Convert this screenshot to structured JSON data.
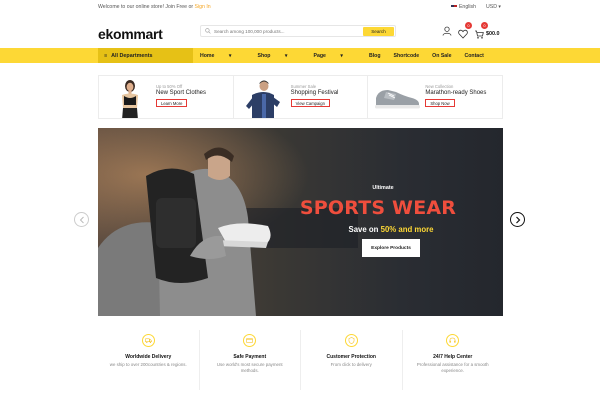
{
  "topbar": {
    "welcome": "Welcome to our online store! Join Free or",
    "signin": "Sign In",
    "language": "English",
    "currency": "USD"
  },
  "header": {
    "logo": "ekommart",
    "search_placeholder": "Search among 100,000 products...",
    "search_button": "Search",
    "wishlist_count": "0",
    "cart_count": "0",
    "cart_price": "$00.0"
  },
  "nav": {
    "departments": "All Departments",
    "items": [
      "Home",
      "Shop",
      "Page",
      "Blog",
      "Shortcode",
      "On Sale",
      "Contact"
    ]
  },
  "promos": [
    {
      "small": "Up to 50% Off",
      "title": "New Sport Clothes",
      "button": "Learn More"
    },
    {
      "small": "Summer Sale",
      "title": "Shopping Festival",
      "button": "View Campaign"
    },
    {
      "small": "New Collection",
      "title": "Marathon-ready Shoes",
      "button": "Shop Now"
    }
  ],
  "hero": {
    "kicker": "Ultimate",
    "headline": "SPORTS WEAR",
    "subline_prefix": "Save on",
    "subline_highlight": "50% and more",
    "cta": "Explore Products"
  },
  "features": [
    {
      "title": "Worldwide Delivery",
      "desc": "we ship to over 200countries & regions.",
      "icon": "truck-icon"
    },
    {
      "title": "Safe Payment",
      "desc": "Use world's most secure payment methods.",
      "icon": "payment-icon"
    },
    {
      "title": "Customer Protection",
      "desc": "From click to delivery",
      "icon": "shield-icon"
    },
    {
      "title": "24/7 Help Center",
      "desc": "Professional assistance for a smooth experience.",
      "icon": "help-icon"
    }
  ],
  "colors": {
    "accent": "#fdd835",
    "headline": "#ef4e3d",
    "badge": "#e53935"
  }
}
